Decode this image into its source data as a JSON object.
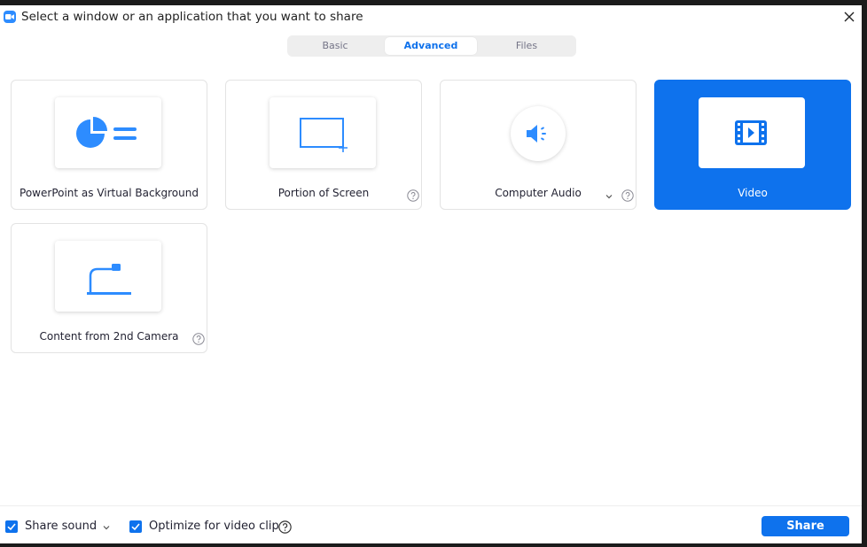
{
  "window": {
    "title": "Select a window or an application that you want to share"
  },
  "tabs": [
    {
      "label": "Basic",
      "active": false
    },
    {
      "label": "Advanced",
      "active": true
    },
    {
      "label": "Files",
      "active": false
    }
  ],
  "options": [
    {
      "label": "PowerPoint as Virtual Background",
      "icon": "pie-chart-slides-icon",
      "selected": false
    },
    {
      "label": "Portion of Screen",
      "icon": "screen-portion-icon",
      "selected": false,
      "help": true
    },
    {
      "label": "Computer Audio",
      "icon": "speaker-icon",
      "selected": false,
      "help": true,
      "dropdown": true
    },
    {
      "label": "Video",
      "icon": "video-film-icon",
      "selected": true
    },
    {
      "label": "Content from 2nd Camera",
      "icon": "document-camera-icon",
      "selected": false,
      "help": true
    }
  ],
  "footer": {
    "share_sound": {
      "label": "Share sound",
      "checked": true
    },
    "optimize_video": {
      "label": "Optimize for video clip",
      "checked": true
    },
    "share_button": "Share"
  },
  "colors": {
    "accent": "#0e72ed",
    "accent_text": "#0e71eb",
    "icon_blue": "#2d8cff"
  }
}
